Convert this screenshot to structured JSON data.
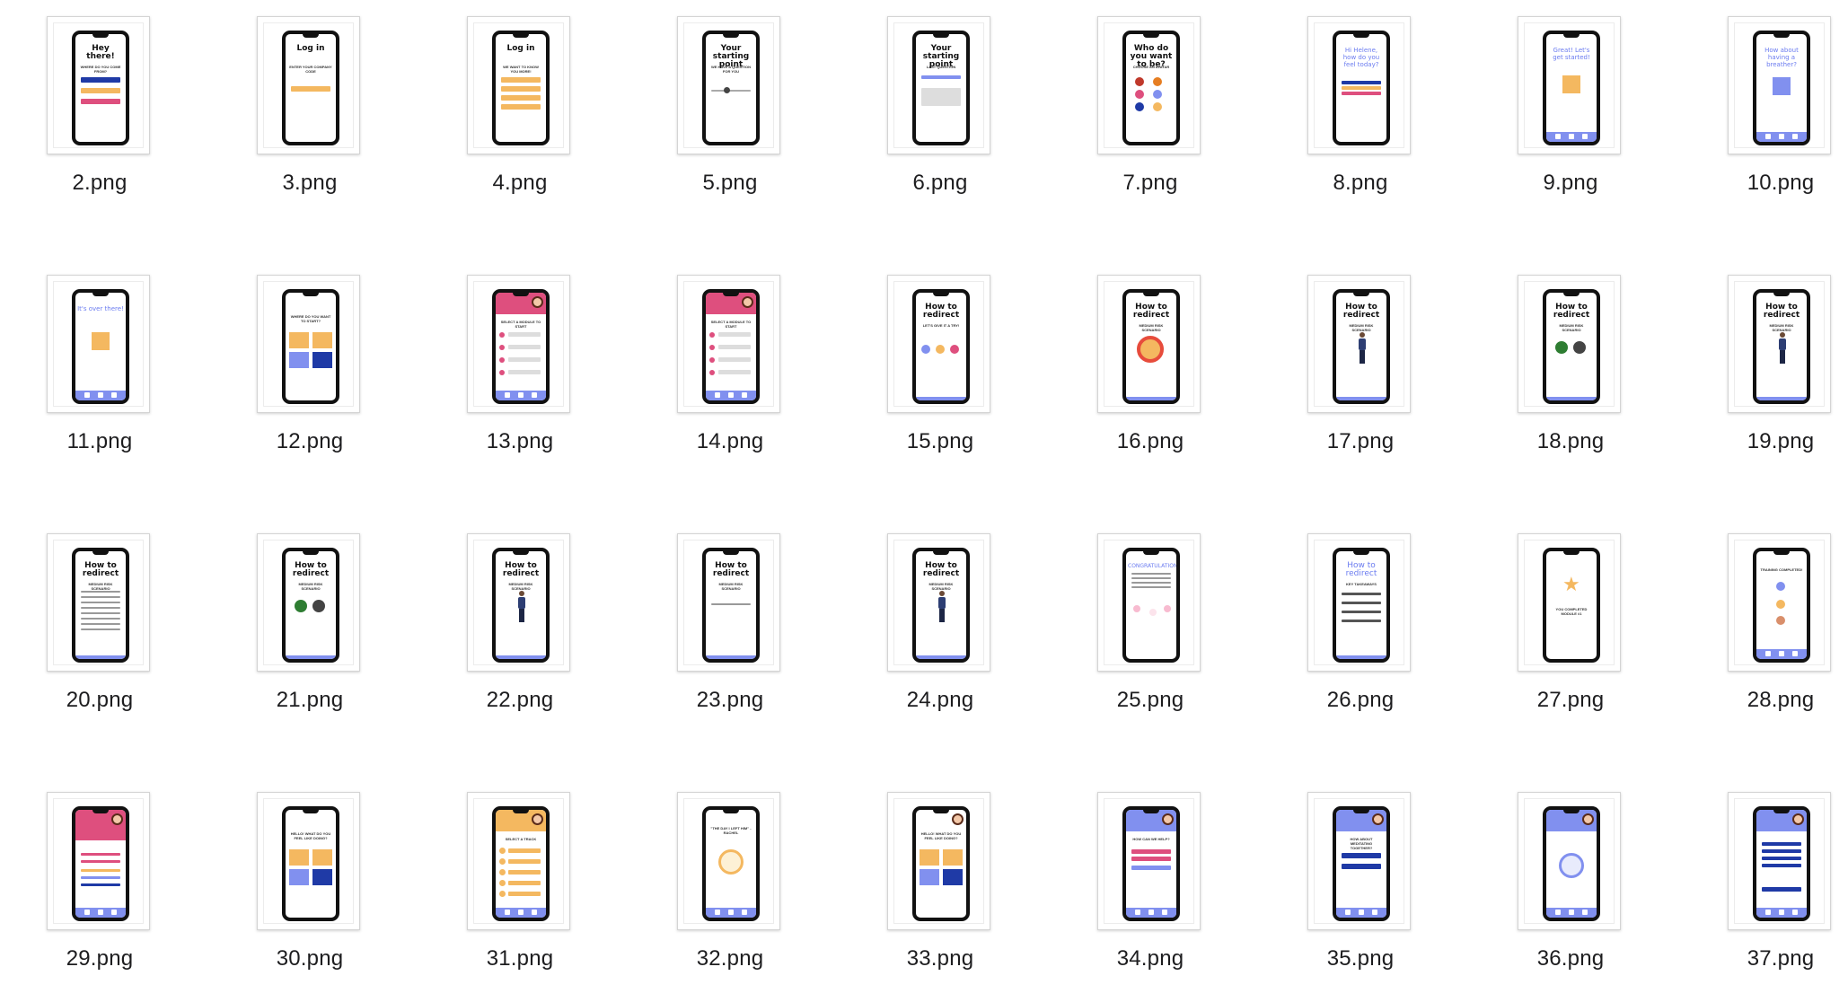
{
  "files": [
    {
      "name": "2.png",
      "screen": {
        "title": "Hey there!",
        "subtitle": "WHERE DO YOU COME FROM?",
        "style": "welcome"
      }
    },
    {
      "name": "3.png",
      "screen": {
        "title": "Log in",
        "subtitle": "ENTER YOUR COMPANY CODE",
        "style": "login"
      }
    },
    {
      "name": "4.png",
      "screen": {
        "title": "Log in",
        "subtitle": "WE WANT TO KNOW YOU MORE!",
        "style": "login-form"
      }
    },
    {
      "name": "5.png",
      "screen": {
        "title": "Your starting point",
        "subtitle": "WE HAVE A QUESTION FOR YOU",
        "style": "slider"
      }
    },
    {
      "name": "6.png",
      "screen": {
        "title": "Your starting point",
        "subtitle": "LAST QUESTION",
        "style": "textbox"
      }
    },
    {
      "name": "7.png",
      "screen": {
        "title": "Who do you want to be?",
        "subtitle": "CHOOSE AN AVATAR",
        "style": "avatars"
      }
    },
    {
      "name": "8.png",
      "screen": {
        "title": "Hi Helene, how do you feel today?",
        "subtitle": "",
        "style": "mood"
      }
    },
    {
      "name": "9.png",
      "screen": {
        "title": "Great! Let's get started!",
        "subtitle": "",
        "style": "start"
      }
    },
    {
      "name": "10.png",
      "screen": {
        "title": "How about having a breather?",
        "subtitle": "",
        "style": "breather"
      }
    },
    {
      "name": "11.png",
      "screen": {
        "title": "It's over there!",
        "subtitle": "",
        "style": "over"
      }
    },
    {
      "name": "12.png",
      "screen": {
        "title": "",
        "subtitle": "WHERE DO YOU WANT TO START?",
        "style": "tiles"
      }
    },
    {
      "name": "13.png",
      "screen": {
        "title": "",
        "subtitle": "SELECT A MODULE TO START",
        "style": "modules"
      }
    },
    {
      "name": "14.png",
      "screen": {
        "title": "",
        "subtitle": "SELECT A MODULE TO START",
        "style": "modules"
      }
    },
    {
      "name": "15.png",
      "screen": {
        "title": "How to redirect",
        "subtitle": "LET'S GIVE IT A TRY!",
        "style": "dots"
      }
    },
    {
      "name": "16.png",
      "screen": {
        "title": "How to redirect",
        "subtitle": "MEDIUM RISK SCENARIO",
        "style": "ring"
      }
    },
    {
      "name": "17.png",
      "screen": {
        "title": "How to redirect",
        "subtitle": "MEDIUM RISK SCENARIO",
        "style": "figure"
      }
    },
    {
      "name": "18.png",
      "screen": {
        "title": "How to redirect",
        "subtitle": "MEDIUM RISK SCENARIO",
        "style": "choice"
      }
    },
    {
      "name": "19.png",
      "screen": {
        "title": "How to redirect",
        "subtitle": "MEDIUM RISK SCENARIO",
        "style": "figure"
      }
    },
    {
      "name": "20.png",
      "screen": {
        "title": "How to redirect",
        "subtitle": "MEDIUM RISK SCENARIO",
        "style": "text"
      }
    },
    {
      "name": "21.png",
      "screen": {
        "title": "How to redirect",
        "subtitle": "MEDIUM RISK SCENARIO",
        "style": "choice"
      }
    },
    {
      "name": "22.png",
      "screen": {
        "title": "How to redirect",
        "subtitle": "MEDIUM RISK SCENARIO",
        "style": "figure"
      }
    },
    {
      "name": "23.png",
      "screen": {
        "title": "How to redirect",
        "subtitle": "MEDIUM RISK SCENARIO",
        "style": "short"
      }
    },
    {
      "name": "24.png",
      "screen": {
        "title": "How to redirect",
        "subtitle": "MEDIUM RISK SCENARIO",
        "style": "figure"
      }
    },
    {
      "name": "25.png",
      "screen": {
        "title": "CONGRATULATIONS",
        "subtitle": "",
        "style": "congrats"
      }
    },
    {
      "name": "26.png",
      "screen": {
        "title": "How to redirect",
        "subtitle": "KEY TAKEAWAYS",
        "style": "takeaways"
      }
    },
    {
      "name": "27.png",
      "screen": {
        "title": "",
        "subtitle": "YOU COMPLETED MODULE #1",
        "style": "star"
      }
    },
    {
      "name": "28.png",
      "screen": {
        "title": "",
        "subtitle": "TRAINING COMPLETED!",
        "style": "icons"
      }
    },
    {
      "name": "29.png",
      "screen": {
        "title": "",
        "subtitle": "",
        "style": "profile"
      }
    },
    {
      "name": "30.png",
      "screen": {
        "title": "",
        "subtitle": "HELLO! WHAT DO YOU FEEL LIKE DOING?",
        "style": "tiles"
      }
    },
    {
      "name": "31.png",
      "screen": {
        "title": "",
        "subtitle": "SELECT A TRACK",
        "style": "tracks"
      }
    },
    {
      "name": "32.png",
      "screen": {
        "title": "",
        "subtitle": "\"THE DAY I LEFT HIM\" - RACHEL",
        "style": "play"
      }
    },
    {
      "name": "33.png",
      "screen": {
        "title": "",
        "subtitle": "HELLO! WHAT DO YOU FEEL LIKE DOING?",
        "style": "tiles-avatar"
      }
    },
    {
      "name": "34.png",
      "screen": {
        "title": "",
        "subtitle": "HOW CAN WE HELP?",
        "style": "help"
      }
    },
    {
      "name": "35.png",
      "screen": {
        "title": "",
        "subtitle": "HOW ABOUT MEDITATING TOGETHER?",
        "style": "meditate"
      }
    },
    {
      "name": "36.png",
      "screen": {
        "title": "",
        "subtitle": "",
        "style": "play-blue"
      }
    },
    {
      "name": "37.png",
      "screen": {
        "title": "",
        "subtitle": "",
        "style": "list-blue"
      }
    }
  ],
  "colors": {
    "blue": "#8190ef",
    "navy": "#1f3aa6",
    "pink": "#de4f7e",
    "orange": "#f4b860",
    "text": "#1d1d1f"
  }
}
